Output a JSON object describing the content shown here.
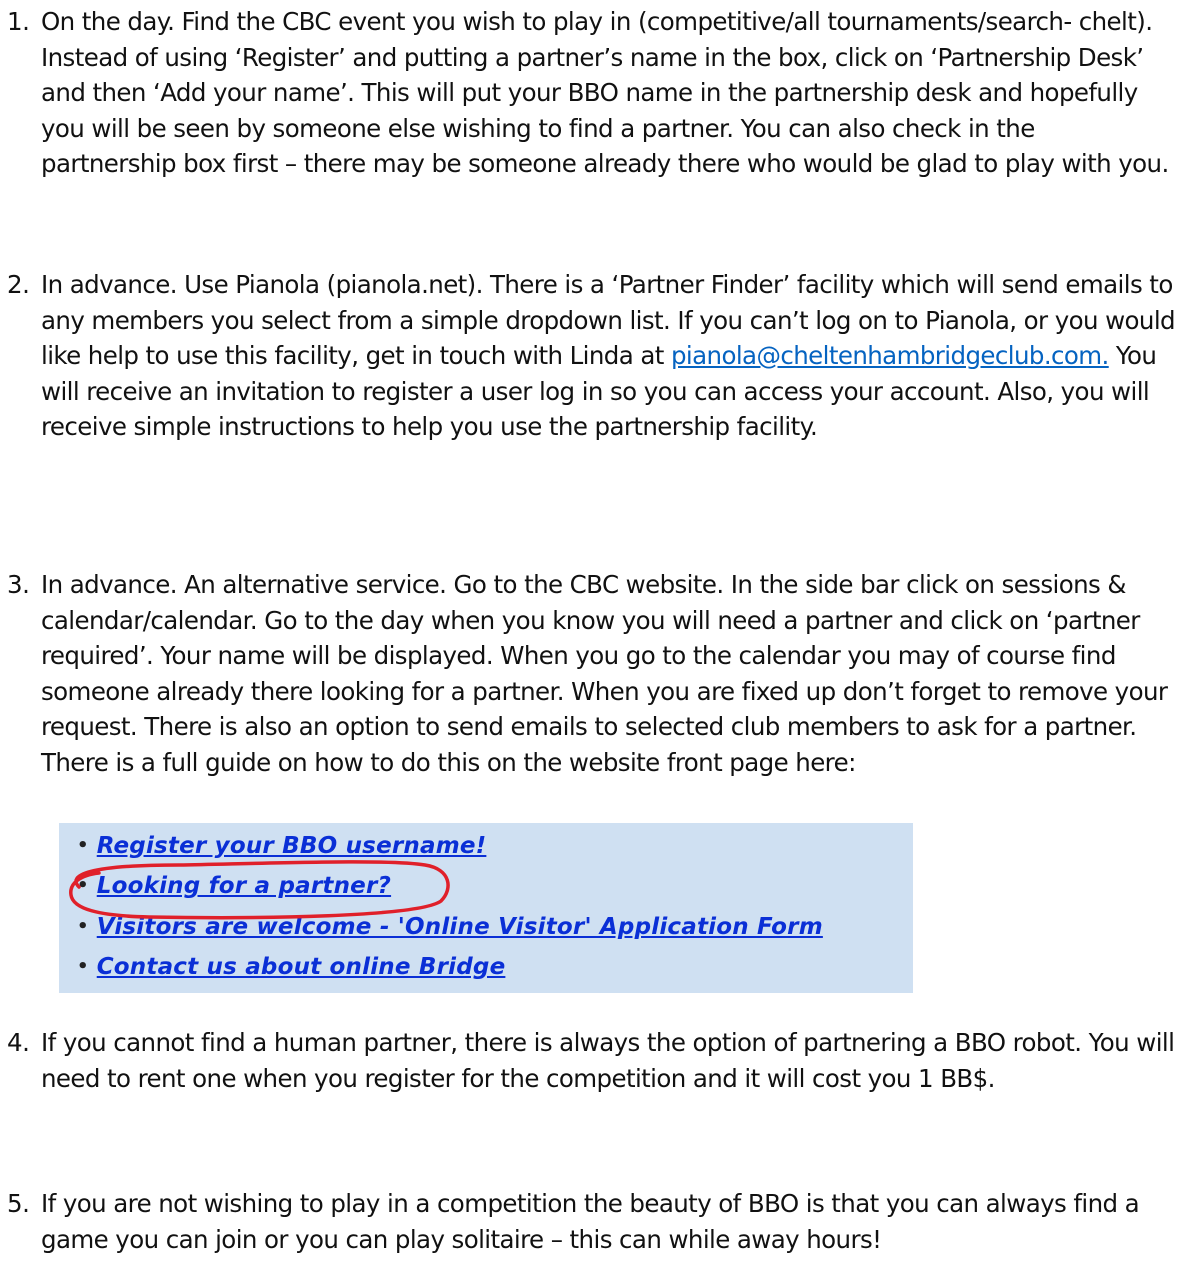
{
  "items": [
    {
      "number": "1.",
      "text": "On the day.  Find the CBC event you wish to play in (competitive/all tournaments/search- chelt). Instead of using ‘Register’ and putting a partner’s name in the box, click on ‘Partnership Desk’ and then ‘Add your name’.  This will put your BBO name in the partnership desk and hopefully you will be seen by someone else wishing to find a partner.  You can also check in the partnership box first – there may be someone already there who would be glad to play with you."
    },
    {
      "number": "2.",
      "text_before": "In advance.  Use Pianola (pianola.net).  There is a ‘Partner Finder’ facility which will send emails to any members you select from a simple dropdown list.   If you can’t log on to Pianola, or you would like help to use this facility, get in touch with Linda at ",
      "link": "pianola@cheltenhambridgeclub.com.",
      "text_after": " You will receive an invitation to register a user log in so you can access your account. Also, you will receive simple instructions to help you use the partnership facility."
    },
    {
      "number": "3.",
      "text": "In advance.  An alternative service.  Go to the CBC website.  In the side bar click on sessions & calendar/calendar.  Go to the day when you know you will need a partner and click on ‘partner required’.  Your name will be displayed.  When you go to the calendar you may of course find someone already there looking for a partner.  When you are fixed up don’t forget to remove your request. There is also an option to send emails to selected club members to ask for a partner. There is a full guide on how to do this on the website front page here:"
    },
    {
      "number": "4.",
      "text": "If you cannot find a human partner, there is always the option of partnering a BBO robot. You will need to rent one when you register for the competition and it will cost you 1 BB$."
    },
    {
      "number": "5.",
      "text": "If you are not wishing to play in a competition the beauty of BBO is that you can always find a game you can join or you can play solitaire – this can while away hours!"
    }
  ],
  "website_snippet": {
    "links": [
      "Register your BBO username!",
      "Looking for a partner?",
      "Visitors are welcome - 'Online Visitor' Application Form",
      "Contact us about online Bridge"
    ],
    "bullet": "•",
    "background_color": "#cfe0f2",
    "link_color": "#0a2fd6",
    "highlight_color": "#e0202a"
  }
}
